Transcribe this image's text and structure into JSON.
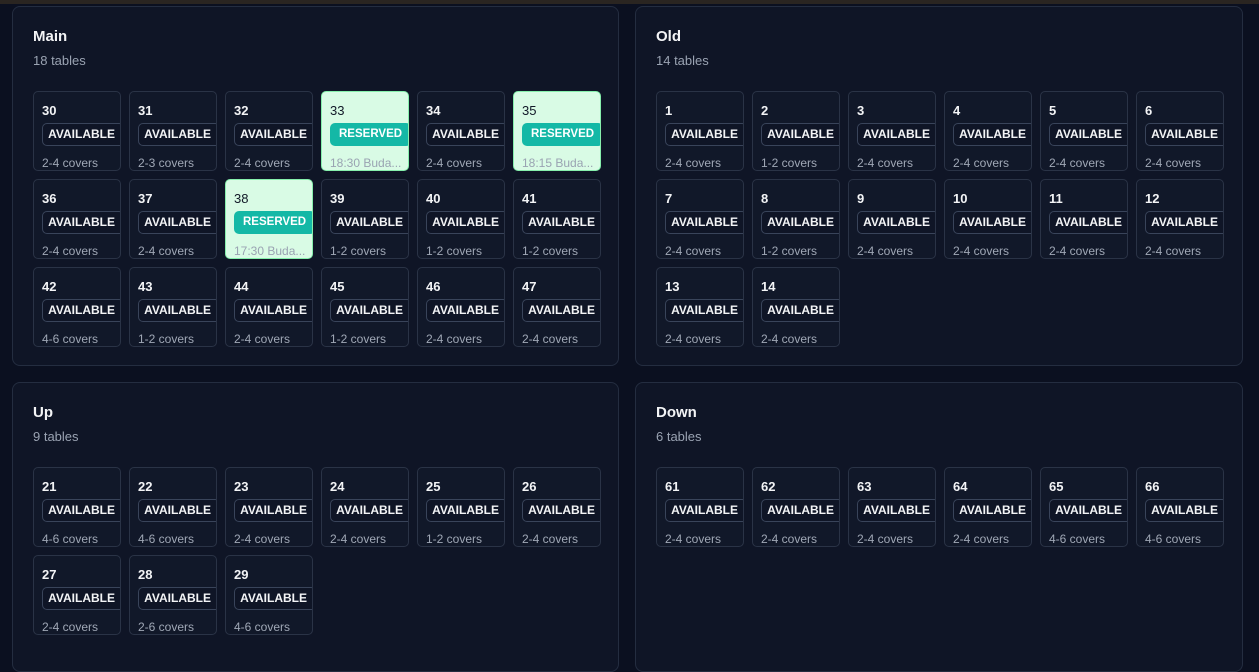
{
  "sections": [
    {
      "title": "Main",
      "count": "18 tables",
      "tables": [
        {
          "num": "30",
          "status": "AVAILABLE",
          "info": "2-4 covers",
          "reserved": false
        },
        {
          "num": "31",
          "status": "AVAILABLE",
          "info": "2-3 covers",
          "reserved": false
        },
        {
          "num": "32",
          "status": "AVAILABLE",
          "info": "2-4 covers",
          "reserved": false
        },
        {
          "num": "33",
          "status": "RESERVED",
          "info": "18:30 Buda...",
          "reserved": true
        },
        {
          "num": "34",
          "status": "AVAILABLE",
          "info": "2-4 covers",
          "reserved": false
        },
        {
          "num": "35",
          "status": "RESERVED",
          "info": "18:15 Buda...",
          "reserved": true
        },
        {
          "num": "36",
          "status": "AVAILABLE",
          "info": "2-4 covers",
          "reserved": false
        },
        {
          "num": "37",
          "status": "AVAILABLE",
          "info": "2-4 covers",
          "reserved": false
        },
        {
          "num": "38",
          "status": "RESERVED",
          "info": "17:30 Buda...",
          "reserved": true
        },
        {
          "num": "39",
          "status": "AVAILABLE",
          "info": "1-2 covers",
          "reserved": false
        },
        {
          "num": "40",
          "status": "AVAILABLE",
          "info": "1-2 covers",
          "reserved": false
        },
        {
          "num": "41",
          "status": "AVAILABLE",
          "info": "1-2 covers",
          "reserved": false
        },
        {
          "num": "42",
          "status": "AVAILABLE",
          "info": "4-6 covers",
          "reserved": false
        },
        {
          "num": "43",
          "status": "AVAILABLE",
          "info": "1-2 covers",
          "reserved": false
        },
        {
          "num": "44",
          "status": "AVAILABLE",
          "info": "2-4 covers",
          "reserved": false
        },
        {
          "num": "45",
          "status": "AVAILABLE",
          "info": "1-2 covers",
          "reserved": false
        },
        {
          "num": "46",
          "status": "AVAILABLE",
          "info": "2-4 covers",
          "reserved": false
        },
        {
          "num": "47",
          "status": "AVAILABLE",
          "info": "2-4 covers",
          "reserved": false
        }
      ]
    },
    {
      "title": "Old",
      "count": "14 tables",
      "tables": [
        {
          "num": "1",
          "status": "AVAILABLE",
          "info": "2-4 covers",
          "reserved": false
        },
        {
          "num": "2",
          "status": "AVAILABLE",
          "info": "1-2 covers",
          "reserved": false
        },
        {
          "num": "3",
          "status": "AVAILABLE",
          "info": "2-4 covers",
          "reserved": false
        },
        {
          "num": "4",
          "status": "AVAILABLE",
          "info": "2-4 covers",
          "reserved": false
        },
        {
          "num": "5",
          "status": "AVAILABLE",
          "info": "2-4 covers",
          "reserved": false
        },
        {
          "num": "6",
          "status": "AVAILABLE",
          "info": "2-4 covers",
          "reserved": false
        },
        {
          "num": "7",
          "status": "AVAILABLE",
          "info": "2-4 covers",
          "reserved": false
        },
        {
          "num": "8",
          "status": "AVAILABLE",
          "info": "1-2 covers",
          "reserved": false
        },
        {
          "num": "9",
          "status": "AVAILABLE",
          "info": "2-4 covers",
          "reserved": false
        },
        {
          "num": "10",
          "status": "AVAILABLE",
          "info": "2-4 covers",
          "reserved": false
        },
        {
          "num": "11",
          "status": "AVAILABLE",
          "info": "2-4 covers",
          "reserved": false
        },
        {
          "num": "12",
          "status": "AVAILABLE",
          "info": "2-4 covers",
          "reserved": false
        },
        {
          "num": "13",
          "status": "AVAILABLE",
          "info": "2-4 covers",
          "reserved": false
        },
        {
          "num": "14",
          "status": "AVAILABLE",
          "info": "2-4 covers",
          "reserved": false
        }
      ]
    },
    {
      "title": "Up",
      "count": "9 tables",
      "tables": [
        {
          "num": "21",
          "status": "AVAILABLE",
          "info": "4-6 covers",
          "reserved": false
        },
        {
          "num": "22",
          "status": "AVAILABLE",
          "info": "4-6 covers",
          "reserved": false
        },
        {
          "num": "23",
          "status": "AVAILABLE",
          "info": "2-4 covers",
          "reserved": false
        },
        {
          "num": "24",
          "status": "AVAILABLE",
          "info": "2-4 covers",
          "reserved": false
        },
        {
          "num": "25",
          "status": "AVAILABLE",
          "info": "1-2 covers",
          "reserved": false
        },
        {
          "num": "26",
          "status": "AVAILABLE",
          "info": "2-4 covers",
          "reserved": false
        },
        {
          "num": "27",
          "status": "AVAILABLE",
          "info": "2-4 covers",
          "reserved": false
        },
        {
          "num": "28",
          "status": "AVAILABLE",
          "info": "2-6 covers",
          "reserved": false
        },
        {
          "num": "29",
          "status": "AVAILABLE",
          "info": "4-6 covers",
          "reserved": false
        }
      ]
    },
    {
      "title": "Down",
      "count": "6 tables",
      "tables": [
        {
          "num": "61",
          "status": "AVAILABLE",
          "info": "2-4 covers",
          "reserved": false
        },
        {
          "num": "62",
          "status": "AVAILABLE",
          "info": "2-4 covers",
          "reserved": false
        },
        {
          "num": "63",
          "status": "AVAILABLE",
          "info": "2-4 covers",
          "reserved": false
        },
        {
          "num": "64",
          "status": "AVAILABLE",
          "info": "2-4 covers",
          "reserved": false
        },
        {
          "num": "65",
          "status": "AVAILABLE",
          "info": "4-6 covers",
          "reserved": false
        },
        {
          "num": "66",
          "status": "AVAILABLE",
          "info": "4-6 covers",
          "reserved": false
        }
      ]
    }
  ],
  "colors": {
    "background": "#0b1020",
    "panel": "#0f1526",
    "reserved_card": "#d9fbe5",
    "reserved_badge": "#14b8a6"
  }
}
